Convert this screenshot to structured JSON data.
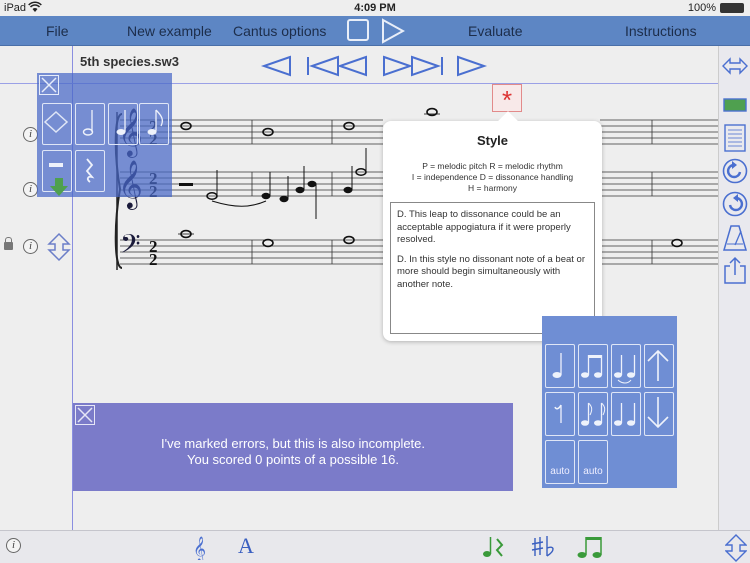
{
  "status": {
    "carrier": "iPad",
    "time": "4:09 PM",
    "battery": "100%"
  },
  "menu": {
    "file": "File",
    "new_example": "New example",
    "cantus_options": "Cantus options",
    "evaluate": "Evaluate",
    "instructions": "Instructions"
  },
  "document": {
    "filename": "5th species.sw3"
  },
  "error_marker": "*",
  "popover": {
    "title": "Style",
    "legend": [
      "P = melodic pitch  R = melodic rhythm",
      "I = independence  D = dissonance handling",
      "H = harmony"
    ],
    "comments": [
      "D. This leap to dissonance could be an acceptable appogiatura if it were properly resolved.",
      "D. In this style no dissonant note of a beat or more should begin simultaneously with another note."
    ]
  },
  "message": {
    "line1": "I've marked errors, but this is also incomplete.",
    "line2": "You scored 0 points of a possible  16."
  },
  "rhythm_palette": {
    "auto1": "auto",
    "auto2": "auto"
  },
  "score": {
    "time_signature_top": "2",
    "time_signature_bottom": "2"
  },
  "bottom": {
    "text_tool": "A"
  },
  "colors": {
    "accent": "#5d86c4",
    "panel": "#4868c8",
    "message": "#7b7bc9",
    "error": "#d33333",
    "green": "#3a9a3a"
  }
}
